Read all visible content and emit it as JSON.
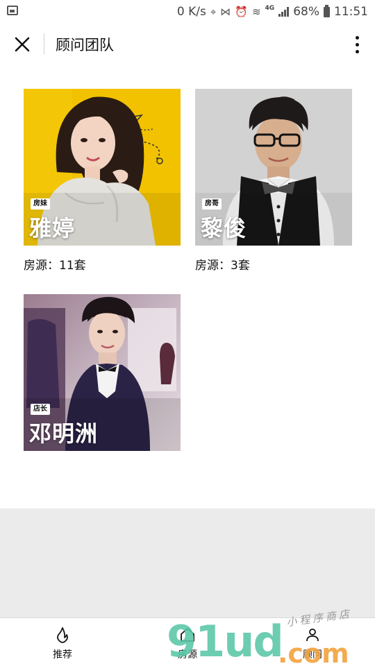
{
  "status_bar": {
    "net_speed": "0 K/s",
    "network_type": "4G",
    "battery": "68%",
    "time": "11:51"
  },
  "nav": {
    "title": "顾问团队",
    "close_icon": "close-icon",
    "more_icon": "more-vertical-icon"
  },
  "advisors": [
    {
      "tag": "房妹",
      "name": "雅婷",
      "listings": "房源：11套"
    },
    {
      "tag": "房哥",
      "name": "黎俊",
      "listings": "房源：3套"
    },
    {
      "tag": "店长",
      "name": "邓明洲"
    }
  ],
  "tabbar": {
    "items": [
      {
        "label": "推荐",
        "icon": "flame-icon"
      },
      {
        "label": "房源",
        "icon": "house-icon"
      },
      {
        "label": "顾问",
        "icon": "person-icon"
      }
    ]
  },
  "watermark": {
    "main": "91ud",
    "suffix": ".com",
    "small": "小程序商店"
  },
  "colors": {
    "card1_bg": "#f2c200",
    "card2_bg": "#d8d8d8",
    "card3_bg": "#8a6f86",
    "grey_area": "#ebebeb",
    "watermark_green": "#59c7a7",
    "watermark_orange": "#f2a23c"
  }
}
